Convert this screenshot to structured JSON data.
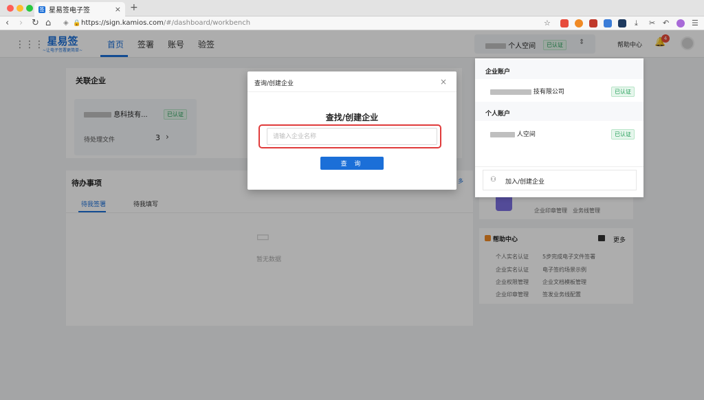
{
  "browser": {
    "tab_title": "星易签电子签",
    "tab_favicon": "签",
    "new_tab": "+",
    "url_host": "https://sign.kamios.com",
    "url_path": "/#/dashboard/workbench"
  },
  "header": {
    "logo_name": "星易签",
    "logo_slogan": "~让电子签署更简单~",
    "nav": [
      "首页",
      "签署",
      "账号",
      "验签"
    ],
    "space_name": "个人空间",
    "space_badge": "已认证",
    "help": "帮助中心",
    "notifications": "4"
  },
  "main": {
    "related_title": "关联企业",
    "company_name": "息科技有...",
    "company_badge": "已认证",
    "pending_files_label": "待处理文件",
    "pending_files_count": "3",
    "todo_title": "待办事项",
    "todo_tabs": [
      "待我签署",
      "待我填写"
    ],
    "empty": "暂无数据",
    "more_link": "多"
  },
  "right": {
    "links_top": [
      "企业印章管理",
      "业务线管理"
    ],
    "help_title": "帮助中心",
    "help_more": "更多",
    "help_links": [
      "个人实名认证",
      "5步完成电子文件签署",
      "企业实名认证",
      "电子签约场景示例",
      "企业权限管理",
      "企业文档模板管理",
      "企业印章管理",
      "签发业务线配置"
    ]
  },
  "dropdown": {
    "enterprise_section": "企业账户",
    "enterprise_name": "技有限公司",
    "enterprise_badge": "已认证",
    "personal_section": "个人账户",
    "personal_name": "人空间",
    "personal_badge": "已认证",
    "join": "加入/创建企业"
  },
  "modal": {
    "title": "查询/创建企业",
    "heading": "查找/创建企业",
    "placeholder": "请输入企业名称",
    "button": "查 询"
  },
  "colors": {
    "accent": "#1b6fd8",
    "highlight": "#e03a3a",
    "verified": "#1f9d55"
  }
}
